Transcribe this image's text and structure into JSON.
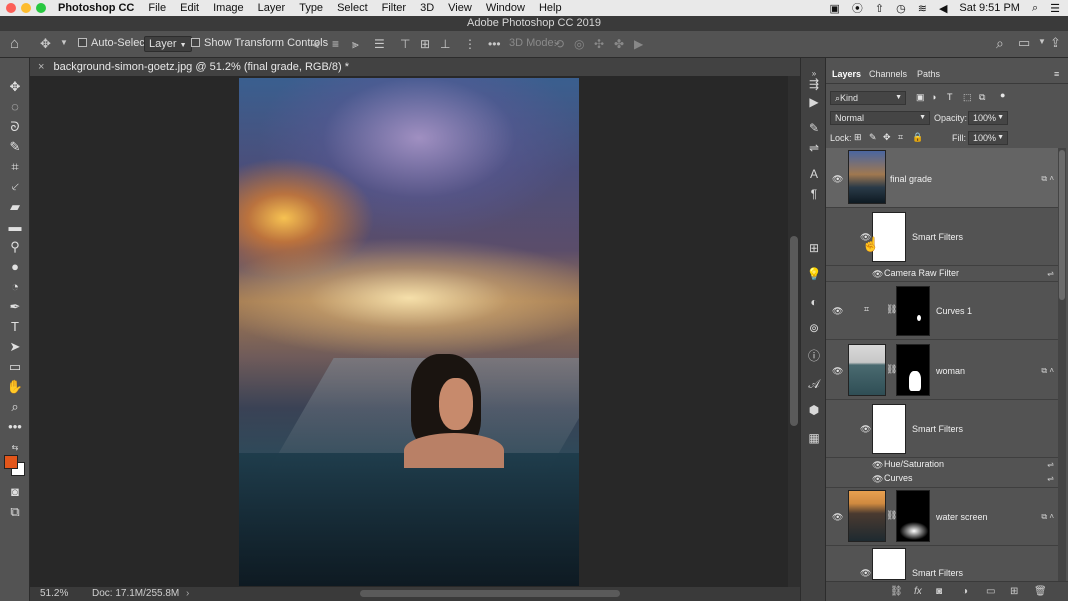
{
  "menubar": {
    "app_name": "Photoshop CC",
    "items": [
      "File",
      "Edit",
      "Image",
      "Layer",
      "Type",
      "Select",
      "Filter",
      "3D",
      "View",
      "Window",
      "Help"
    ],
    "clock": "Sat 9:51 PM"
  },
  "title_bar": {
    "title": "Adobe Photoshop CC 2019"
  },
  "options_bar": {
    "auto_select_label": "Auto-Select:",
    "auto_select_target": "Layer",
    "show_transform_label": "Show Transform Controls",
    "mode_3d_label": "3D Mode:"
  },
  "document_tab": {
    "title": "background-simon-goetz.jpg @ 51.2% (final grade, RGB/8) *"
  },
  "status_bar": {
    "zoom": "51.2%",
    "doc_size": "Doc: 17.1M/255.8M"
  },
  "foreground_color": "#e2561b",
  "background_color": "#ffffff",
  "layers_panel": {
    "tabs": [
      "Layers",
      "Channels",
      "Paths"
    ],
    "filter_kind": "Kind",
    "blend_mode": "Normal",
    "opacity_label": "Opacity:",
    "opacity_value": "100%",
    "lock_label": "Lock:",
    "fill_label": "Fill:",
    "fill_value": "100%",
    "layers": [
      {
        "name": "final grade"
      },
      {
        "name": "Smart Filters"
      },
      {
        "name": "Camera Raw Filter"
      },
      {
        "name": "Curves 1"
      },
      {
        "name": "woman"
      },
      {
        "name": "Smart Filters"
      },
      {
        "name": "Hue/Saturation"
      },
      {
        "name": "Curves"
      },
      {
        "name": "water screen"
      },
      {
        "name": "Smart Filters"
      }
    ]
  }
}
